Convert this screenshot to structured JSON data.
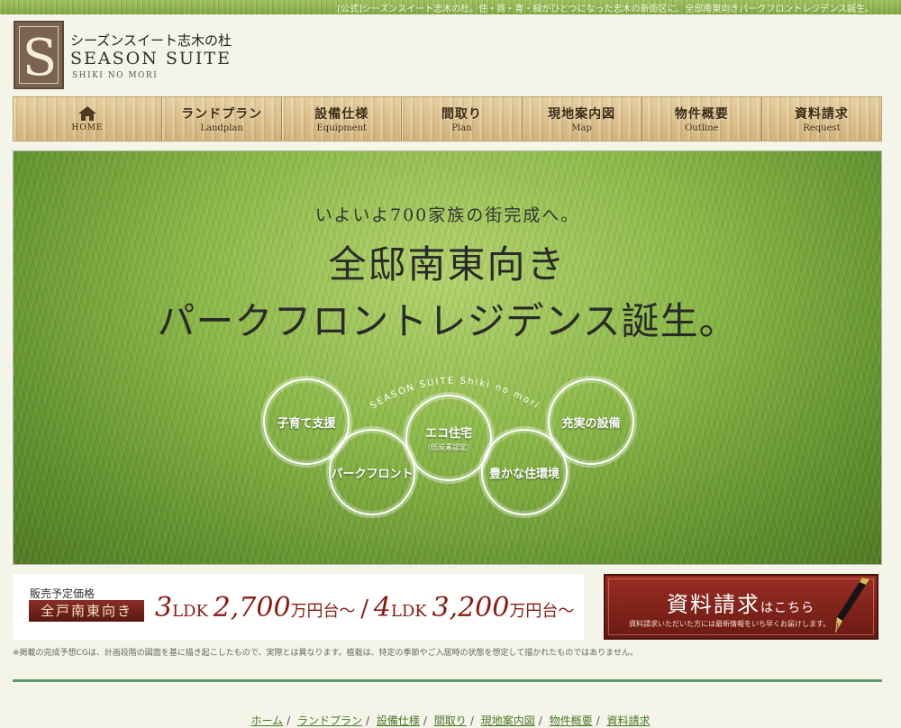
{
  "top_strip": {
    "tagline": "[公式]シーズンスイート志木の杜。住・商・育・緑がひとつになった志木の新街区に、全邸南東向きパークフロントレジデンス誕生。"
  },
  "logo": {
    "letter": "S",
    "jp": "シーズンスイート志木の杜",
    "en": "SEASON SUITE",
    "sub": "SHIKI NO MORI"
  },
  "nav": {
    "home_label": "HOME",
    "items": [
      {
        "jp": "ランドプラン",
        "en": "Landplan"
      },
      {
        "jp": "設備仕様",
        "en": "Equipment"
      },
      {
        "jp": "間取り",
        "en": "Plan"
      },
      {
        "jp": "現地案内図",
        "en": "Map"
      },
      {
        "jp": "物件概要",
        "en": "Outline"
      },
      {
        "jp": "資料請求",
        "en": "Request"
      }
    ]
  },
  "hero": {
    "lead": "いよいよ700家族の街完成へ。",
    "line1": "全邸南東向き",
    "line2": "パークフロントレジデンス誕生。",
    "arc_text": "SEASON SUITE Shiki no mori",
    "features": [
      {
        "title": "子育て支援",
        "sub": ""
      },
      {
        "title": "パークフロント",
        "sub": ""
      },
      {
        "title": "エコ住宅",
        "sub": "（低炭素認定）"
      },
      {
        "title": "豊かな住環境",
        "sub": ""
      },
      {
        "title": "充実の設備",
        "sub": ""
      }
    ]
  },
  "price": {
    "label": "販売予定価格",
    "badge": "全戸南東向き",
    "type1": "3",
    "type1_unit": "LDK",
    "value1": "2,700",
    "suffix1": "万円台〜",
    "separator": "/",
    "type2": "4",
    "type2_unit": "LDK",
    "value2": "3,200",
    "suffix2": "万円台〜"
  },
  "request": {
    "main": "資料請求",
    "small": "はこちら",
    "sub": "資料請求いただいた方には最新情報をいち早くお届けします。"
  },
  "note": "※掲載の完成予想CGは、計画段階の図面を基に描き起こしたもので、実際とは異なります。植栽は、特定の季節やご入居時の状態を想定して描かれたものではありません。",
  "footer_nav": {
    "separator": "/",
    "items": [
      "ホーム",
      "ランドプラン",
      "設備仕様",
      "間取り",
      "現地案内図",
      "物件概要",
      "資料請求"
    ]
  },
  "colors": {
    "accent_red": "#8a1a12",
    "divider_green": "#5b9a62",
    "wood": "#d8bc86",
    "grass": "#8cba48"
  }
}
